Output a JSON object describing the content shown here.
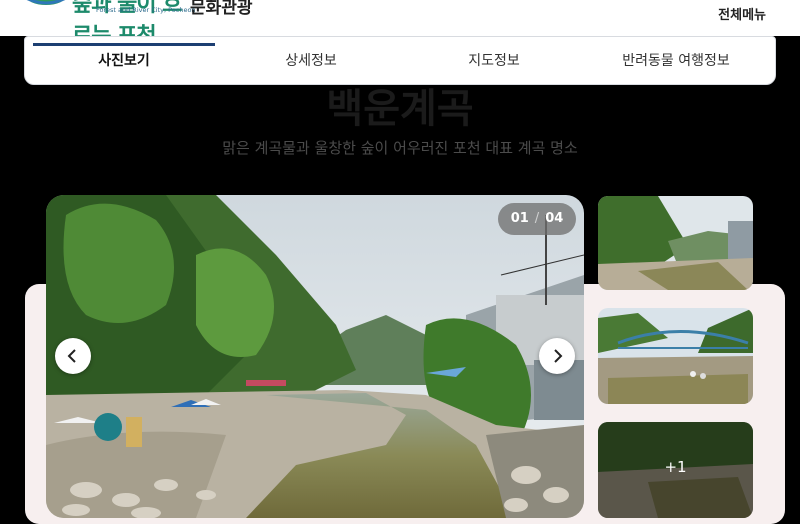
{
  "header": {
    "logo_text": "숲과 물이 흐르는 포천",
    "logo_tagline": "Forest and River City, Pocheon",
    "section_title": "문화관광",
    "all_menu_label": "전체메뉴"
  },
  "tabs": [
    {
      "label": "사진보기",
      "active": true
    },
    {
      "label": "상세정보",
      "active": false
    },
    {
      "label": "지도정보",
      "active": false
    },
    {
      "label": "반려동물 여행정보",
      "active": false
    }
  ],
  "hero": {
    "title": "백운계곡",
    "description": "맑은 계곡물과 울창한 숲이 어우러진 포천 대표 계곡 명소"
  },
  "gallery": {
    "current": "01",
    "total": "04",
    "more_count": "+1",
    "prev_icon": "chevron-left-icon",
    "next_icon": "chevron-right-icon"
  }
}
